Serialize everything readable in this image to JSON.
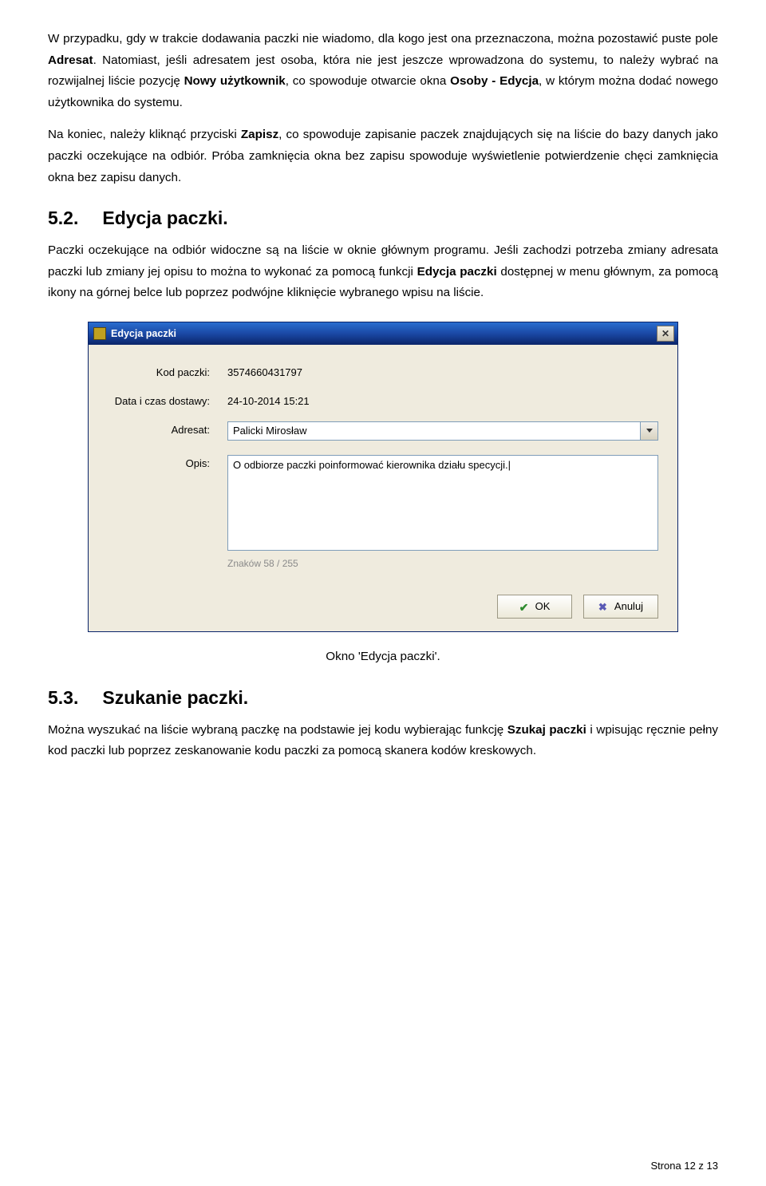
{
  "para1": {
    "t1": "W przypadku, gdy w trakcie dodawania paczki nie wiadomo, dla kogo jest ona przeznaczona, można pozostawić puste pole ",
    "b1": "Adresat",
    "t2": ". Natomiast, jeśli adresatem jest osoba, która nie jest jeszcze wprowadzona do systemu, to należy wybrać na rozwijalnej liście pozycję ",
    "b2": "Nowy użytkownik",
    "t3": ", co spowoduje otwarcie okna ",
    "b3": "Osoby - Edycja",
    "t4": ", w którym można dodać nowego użytkownika do systemu."
  },
  "para2": {
    "t1": "Na koniec, należy kliknąć przyciski ",
    "b1": "Zapisz",
    "t2": ", co spowoduje zapisanie paczek znajdujących się na liście do bazy danych jako paczki oczekujące na odbiór. Próba zamknięcia okna bez zapisu spowoduje wyświetlenie potwierdzenie chęci zamknięcia okna bez zapisu danych."
  },
  "h52": {
    "num": "5.2.",
    "title": "Edycja paczki."
  },
  "para3": {
    "t1": "Paczki oczekujące na odbiór widoczne są na liście w oknie głównym programu. Jeśli zachodzi potrzeba zmiany adresata paczki lub zmiany jej opisu to można to wykonać za pomocą funkcji ",
    "b1": "Edycja paczki",
    "t2": " dostępnej w menu głównym, za pomocą ikony na górnej belce lub poprzez podwójne kliknięcie wybranego wpisu na liście."
  },
  "dialog": {
    "title": "Edycja paczki",
    "labels": {
      "kod": "Kod paczki:",
      "data": "Data i czas dostawy:",
      "adresat": "Adresat:",
      "opis": "Opis:"
    },
    "values": {
      "kod": "3574660431797",
      "data": "24-10-2014 15:21",
      "adresat": "Palicki Mirosław",
      "opis": "O odbiorze paczki poinformować kierownika działu specycji.|"
    },
    "charcount": "Znaków 58 / 255",
    "buttons": {
      "ok": "OK",
      "cancel": "Anuluj"
    }
  },
  "caption": "Okno 'Edycja paczki'.",
  "h53": {
    "num": "5.3.",
    "title": "Szukanie paczki."
  },
  "para4": {
    "t1": "Można wyszukać na liście wybraną paczkę na podstawie jej kodu wybierając funkcję ",
    "b1": "Szukaj paczki",
    "t2": " i wpisując ręcznie pełny kod paczki lub poprzez zeskanowanie kodu paczki za pomocą skanera kodów kreskowych."
  },
  "footer": "Strona 12 z 13"
}
